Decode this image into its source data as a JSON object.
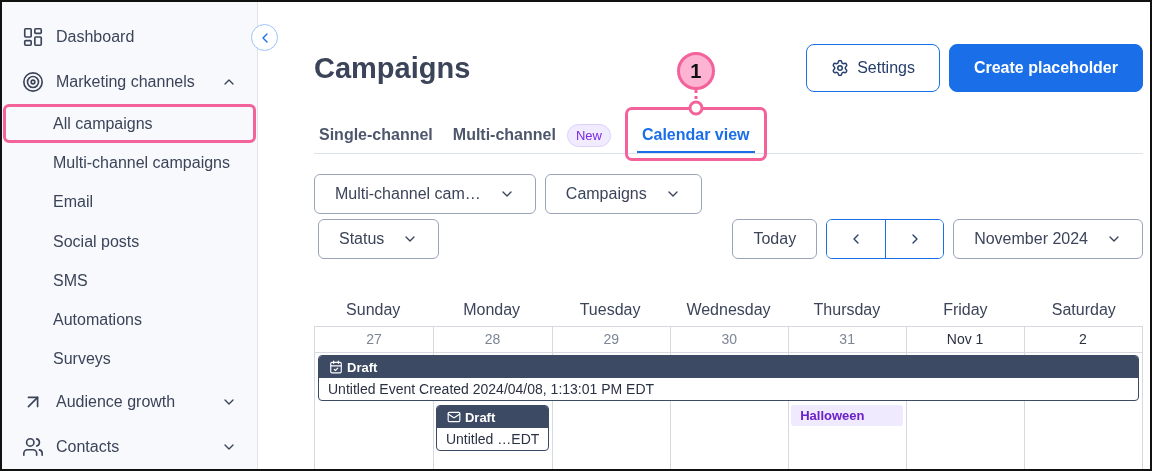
{
  "sidebar": {
    "items": [
      {
        "label": "Dashboard"
      },
      {
        "label": "Marketing channels",
        "expanded": true,
        "children": [
          {
            "label": "All campaigns",
            "highlighted": true
          },
          {
            "label": "Multi-channel campaigns",
            "highlighted": false
          },
          {
            "label": "Email",
            "highlighted": false
          },
          {
            "label": "Social posts",
            "highlighted": false
          },
          {
            "label": "SMS",
            "highlighted": false
          },
          {
            "label": "Automations",
            "highlighted": false
          },
          {
            "label": "Surveys",
            "highlighted": false
          }
        ]
      },
      {
        "label": "Audience growth",
        "expanded": false
      },
      {
        "label": "Contacts",
        "expanded": false
      }
    ]
  },
  "page": {
    "title": "Campaigns",
    "buttons": [
      {
        "label": "Settings",
        "kind": "secondary"
      },
      {
        "label": "Create placeholder",
        "kind": "primary"
      }
    ]
  },
  "tabs": [
    {
      "label": "Single-channel",
      "selected": false
    },
    {
      "label": "Multi-channel",
      "selected": false,
      "badge": "New"
    },
    {
      "label": "Calendar view",
      "selected": true,
      "highlighted": true,
      "callout": "1"
    }
  ],
  "filters": [
    "Multi-channel cam…",
    "Campaigns",
    "Status"
  ],
  "calendar_nav": {
    "today": "Today",
    "month": "November 2024"
  },
  "calendar": {
    "weekdays": [
      "Sunday",
      "Monday",
      "Tuesday",
      "Wednesday",
      "Thursday",
      "Friday",
      "Saturday"
    ],
    "week_events": [
      {
        "kind": "event",
        "status": "Draft",
        "title": "Untitled Event Created 2024/04/08, 1:13:01 PM EDT"
      }
    ],
    "days": [
      {
        "label": "27",
        "current_month": false
      },
      {
        "label": "28",
        "current_month": false,
        "events": [
          {
            "kind": "email",
            "status": "Draft",
            "title": "Untitled …EDT"
          }
        ]
      },
      {
        "label": "29",
        "current_month": false
      },
      {
        "label": "30",
        "current_month": false
      },
      {
        "label": "31",
        "current_month": false,
        "events": [
          {
            "kind": "holiday",
            "title": "Halloween",
            "color": "#6b21c8"
          }
        ]
      },
      {
        "label": "Nov 1",
        "current_month": true
      },
      {
        "label": "2",
        "current_month": true
      }
    ]
  }
}
